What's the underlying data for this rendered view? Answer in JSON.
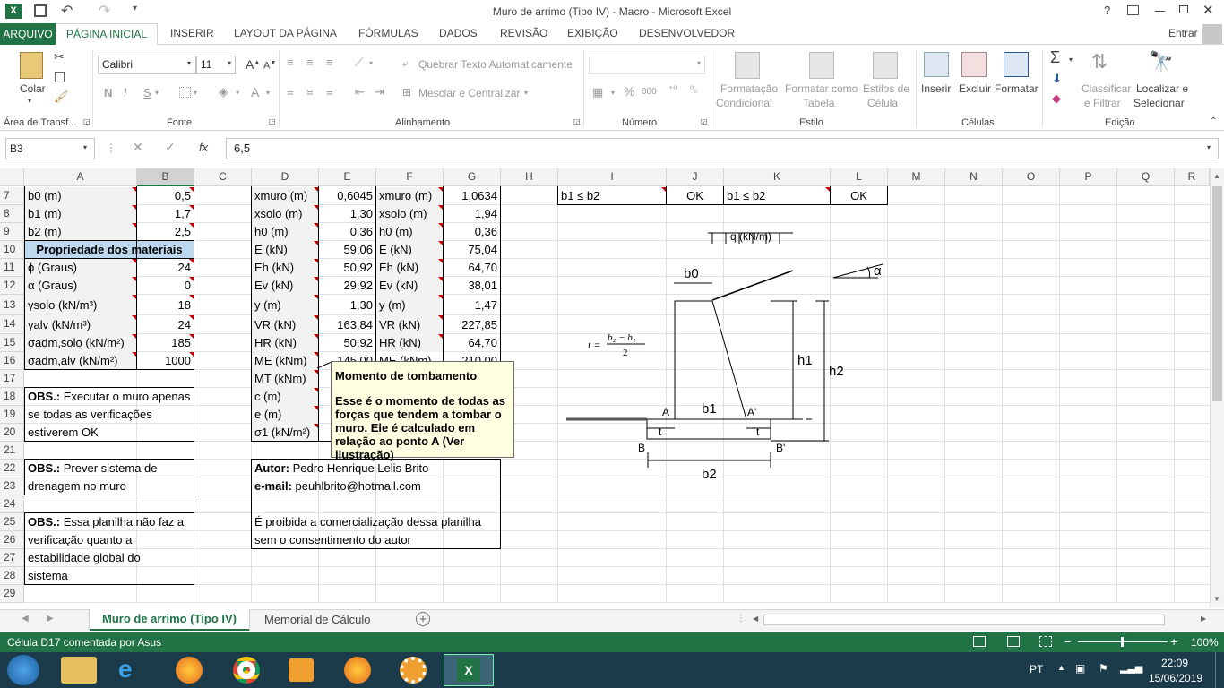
{
  "window": {
    "title": "Muro de arrimo (Tipo IV) - Macro - Microsoft Excel",
    "help": "?",
    "signin": "Entrar"
  },
  "tabs": [
    "ARQUIVO",
    "PÁGINA INICIAL",
    "INSERIR",
    "LAYOUT DA PÁGINA",
    "FÓRMULAS",
    "DADOS",
    "REVISÃO",
    "EXIBIÇÃO",
    "DESENVOLVEDOR"
  ],
  "ribbon": {
    "paste": "Colar",
    "clipboard_group": "Área de Transf...",
    "font_name": "Calibri",
    "font_size": "11",
    "font_group": "Fonte",
    "bold": "N",
    "italic": "I",
    "underline": "S",
    "wrap_text": "Quebrar Texto Automaticamente",
    "merge_center": "Mesclar e Centralizar",
    "alignment_group": "Alinhamento",
    "percent": "%",
    "thousands": "000",
    "number_group": "Número",
    "cond_format_1": "Formatação",
    "cond_format_2": "Condicional",
    "format_table_1": "Formatar como",
    "format_table_2": "Tabela",
    "cell_styles_1": "Estilos de",
    "cell_styles_2": "Célula",
    "styles_group": "Estilo",
    "insert": "Inserir",
    "delete": "Excluir",
    "format": "Formatar",
    "cells_group": "Células",
    "sort_filter_1": "Classificar",
    "sort_filter_2": "e Filtrar",
    "find_select_1": "Localizar e",
    "find_select_2": "Selecionar",
    "editing_group": "Edição"
  },
  "formula_bar": {
    "name_box": "B3",
    "fx": "fx",
    "value": "6,5"
  },
  "columns": [
    "A",
    "B",
    "C",
    "D",
    "E",
    "F",
    "G",
    "H",
    "I",
    "J",
    "K",
    "L",
    "M",
    "N",
    "O",
    "P",
    "Q",
    "R"
  ],
  "rows": [
    "7",
    "8",
    "9",
    "10",
    "11",
    "12",
    "13",
    "14",
    "15",
    "16",
    "17",
    "18",
    "19",
    "20",
    "21",
    "22",
    "23",
    "24",
    "25",
    "26",
    "27",
    "28",
    "29"
  ],
  "cells": {
    "a7": "b0 (m)",
    "b7": "0,5",
    "a8": "b1 (m)",
    "b8": "1,7",
    "a9": "b2 (m)",
    "b9": "2,5",
    "a10": "Propriedade dos materiais",
    "a11": "ϕ (Graus)",
    "b11": "24",
    "a12": "α (Graus)",
    "b12": "0",
    "a13": "γsolo (kN/m³)",
    "b13": "18",
    "a14": "γalv (kN/m³)",
    "b14": "24",
    "a15": "σadm,solo (kN/m²)",
    "b15": "185",
    "a16": "σadm,alv (kN/m²)",
    "b16": "1000",
    "d7": "xmuro (m)",
    "e7": "0,6045",
    "f7": "xmuro (m)",
    "g7": "1,0634",
    "d8": "xsolo (m)",
    "e8": "1,30",
    "f8": "xsolo (m)",
    "g8": "1,94",
    "d9": "h0 (m)",
    "e9": "0,36",
    "f9": "h0 (m)",
    "g9": "0,36",
    "d10": "E (kN)",
    "e10": "59,06",
    "f10": "E (kN)",
    "g10": "75,04",
    "d11": "Eh (kN)",
    "e11": "50,92",
    "f11": "Eh (kN)",
    "g11": "64,70",
    "d12": "Ev (kN)",
    "e12": "29,92",
    "f12": "Ev (kN)",
    "g12": "38,01",
    "d13": "y (m)",
    "e13": "1,30",
    "f13": "y (m)",
    "g13": "1,47",
    "d14": "VR (kN)",
    "e14": "163,84",
    "f14": "VR (kN)",
    "g14": "227,85",
    "d15": "HR (kN)",
    "e15": "50,92",
    "f15": "HR (kN)",
    "g15": "64,70",
    "d16": "ME (kNm)",
    "e16": "145,00",
    "f16": "ME (kNm)",
    "g16": "210,00",
    "d17": "MT (kNm)",
    "d18": "c (m)",
    "d19": "e (m)",
    "d20": "σ1 (kN/m²)",
    "obs1_label": "OBS.:",
    "obs1_l1": " Executar o muro apenas",
    "obs1_l2": "se todas as verificações",
    "obs1_l3": "estiverem OK",
    "obs2_label": "OBS.:",
    "obs2_l1": " Prever sistema de",
    "obs2_l2": "drenagem no muro",
    "obs3_label": "OBS.:",
    "obs3_l1": " Essa planilha não faz a",
    "obs3_l2": "verificação quanto a",
    "obs3_l3": "estabilidade global do",
    "obs3_l4": "sistema",
    "author_label": "Autor:",
    "author": " Pedro Henrique Lelis Brito",
    "email_label": "e-mail:",
    "email": " peuhlbrito@hotmail.com",
    "notice_l1": "É proibida a comercialização dessa planilha",
    "notice_l2": "sem o consentimento do autor",
    "i7": "b1 ≤ b2",
    "j7": "OK",
    "k7": "b1 ≤ b2",
    "l7": "OK"
  },
  "comment": {
    "title": "Momento de tombamento",
    "body": "Esse é o momento de todas as forças que tendem a tombar o muro. Ele é calculado em relação ao ponto A (Ver ilustração)"
  },
  "diagram": {
    "q": "q (kN/m)",
    "b0": "b0",
    "alpha": "α",
    "h1": "h1",
    "h2": "h2",
    "b1": "b1",
    "b2": "b2",
    "A": "A",
    "A2": "A'",
    "B": "B",
    "B2": "B'",
    "t": "t",
    "formula_t": "t =",
    "formula_num": "b₂ − b₁",
    "formula_den": "2"
  },
  "sheets": {
    "active": "Muro de arrimo (Tipo IV)",
    "other": "Memorial de Cálculo"
  },
  "status": {
    "text": "Célula D17 comentada por Asus",
    "zoom": "100%"
  },
  "taskbar": {
    "lang": "PT",
    "time": "22:09",
    "date": "15/06/2019"
  }
}
